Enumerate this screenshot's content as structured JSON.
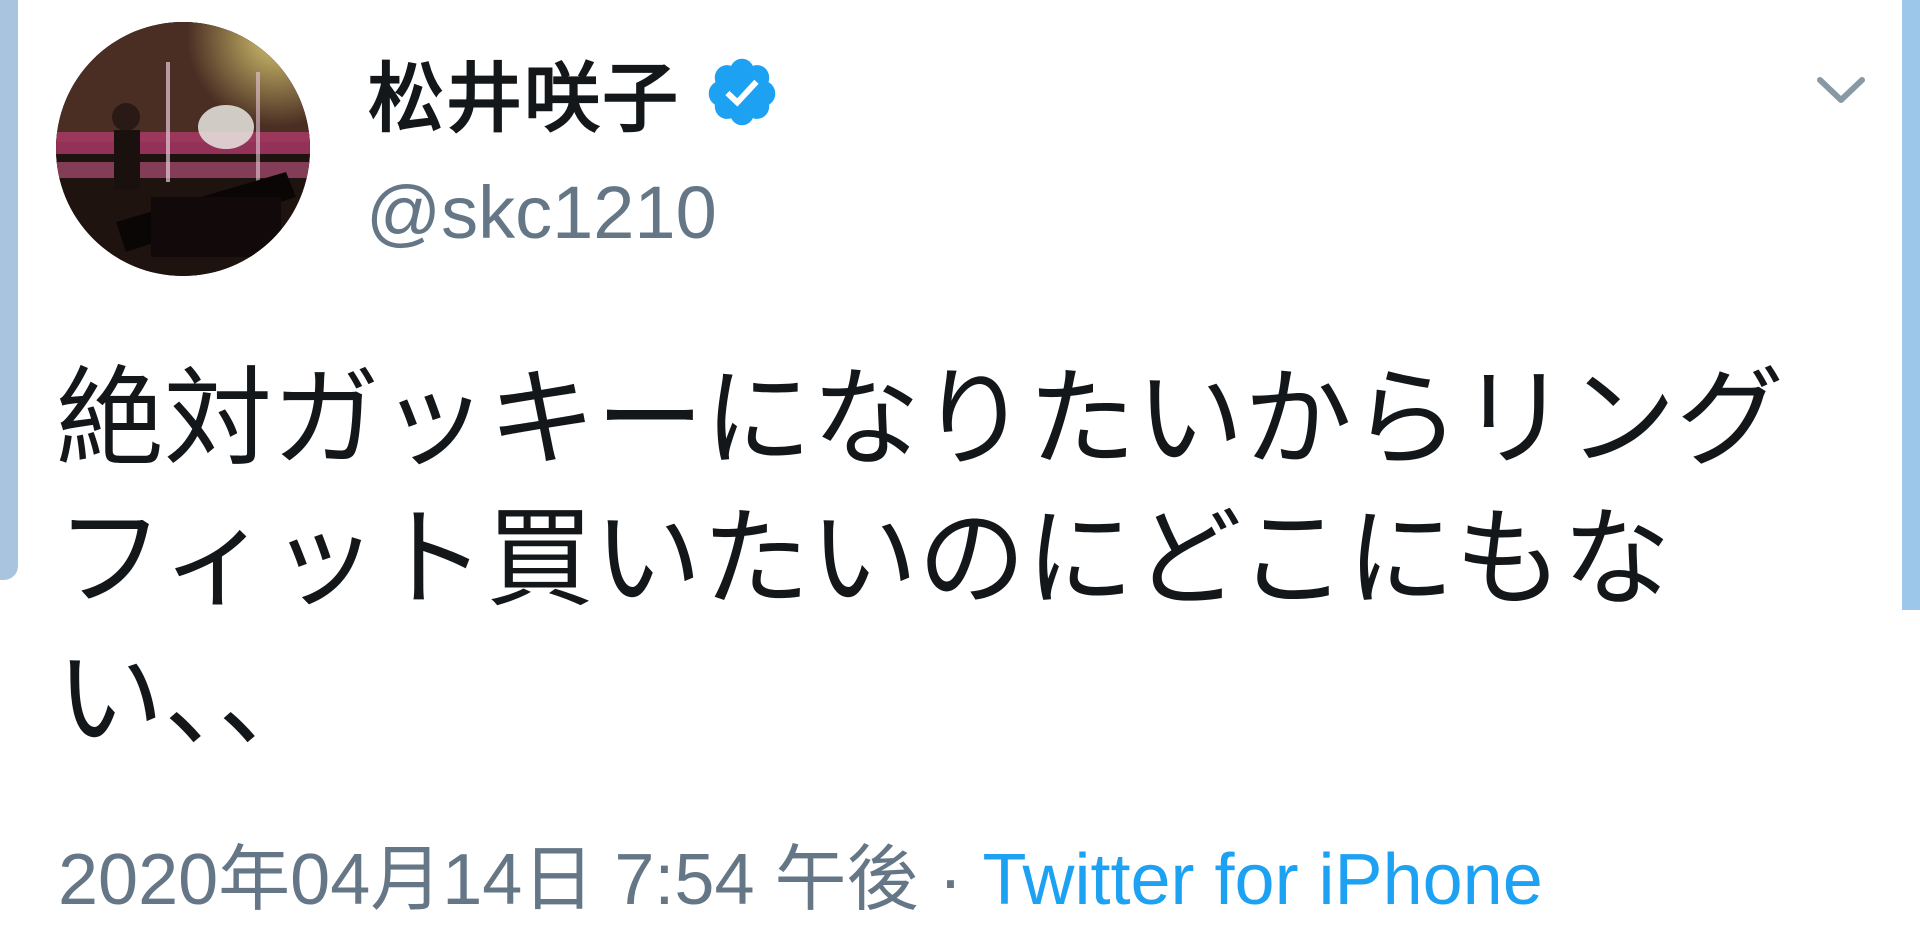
{
  "tweet": {
    "display_name": "松井咲子",
    "verified": true,
    "handle": "@skc1210",
    "text": "絶対ガッキーになりたいからリングフィット買いたいのにどこにもない、、",
    "timestamp": "2020年04月14日 7:54 午後",
    "separator": " · ",
    "source": "Twitter for iPhone"
  },
  "icons": {
    "verified": "verified-badge-icon",
    "caret": "chevron-down-icon"
  },
  "colors": {
    "text": "#14171a",
    "secondary": "#657786",
    "accent": "#1da1f2"
  }
}
